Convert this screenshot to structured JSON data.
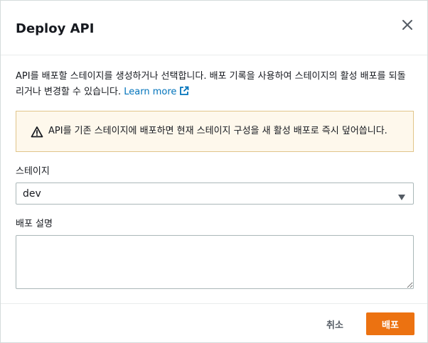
{
  "modal": {
    "title": "Deploy API",
    "close_icon": "close-icon"
  },
  "description": {
    "text": "API를 배포할 스테이지를 생성하거나 선택합니다. 배포 기록을 사용하여 스테이지의 활성 배포를 되돌리거나 변경할 수 있습니다.",
    "link_label": "Learn more",
    "link_icon": "external-link-icon"
  },
  "warning": {
    "icon": "warning-triangle-icon",
    "text": "API를 기존 스테이지에 배포하면 현재 스테이지 구성을 새 활성 배포로 즉시 덮어씁니다."
  },
  "stage_field": {
    "label": "스테이지",
    "selected_value": "dev",
    "caret_icon": "caret-down-icon"
  },
  "description_field": {
    "label": "배포 설명",
    "value": "",
    "placeholder": ""
  },
  "footer": {
    "cancel_label": "취소",
    "deploy_label": "배포"
  },
  "colors": {
    "primary_button": "#ec7211",
    "link": "#0073bb",
    "warning_bg": "#fef8ec",
    "warning_border": "#e1c58a"
  }
}
